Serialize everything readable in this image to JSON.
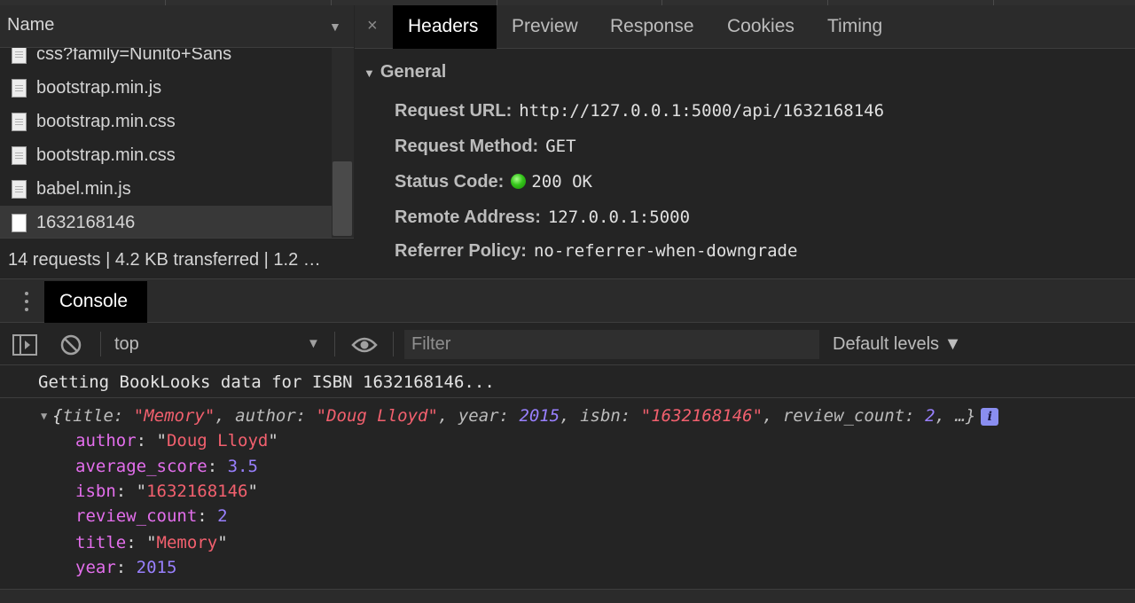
{
  "network": {
    "list_header": "Name",
    "files": [
      {
        "name": "css?family=Nunito+Sans",
        "selected": false,
        "blank": false
      },
      {
        "name": "bootstrap.min.js",
        "selected": false,
        "blank": false
      },
      {
        "name": "bootstrap.min.css",
        "selected": false,
        "blank": false
      },
      {
        "name": "bootstrap.min.css",
        "selected": false,
        "blank": false
      },
      {
        "name": "babel.min.js",
        "selected": false,
        "blank": false
      },
      {
        "name": "1632168146",
        "selected": true,
        "blank": true
      }
    ],
    "summary": "14 requests | 4.2 KB transferred | 1.2 …"
  },
  "detail": {
    "close": "×",
    "tabs": [
      "Headers",
      "Preview",
      "Response",
      "Cookies",
      "Timing"
    ],
    "active_tab": "Headers",
    "section": "General",
    "rows": {
      "url_key": "Request URL:",
      "url_val": "http://127.0.0.1:5000/api/1632168146",
      "method_key": "Request Method:",
      "method_val": "GET",
      "status_key": "Status Code:",
      "status_val": "200 OK",
      "remote_key": "Remote Address:",
      "remote_val": "127.0.0.1:5000",
      "policy_key": "Referrer Policy:",
      "policy_val": "no-referrer-when-downgrade"
    }
  },
  "console": {
    "tab": "Console",
    "context": "top",
    "filter_placeholder": "Filter",
    "levels": "Default levels ▼",
    "log_message": "Getting BookLooks data for ISBN 1632168146...",
    "summary": {
      "open": "{",
      "title_k": "title: ",
      "title_v": "\"Memory\"",
      "author_k": ", author: ",
      "author_v": "\"Doug Lloyd\"",
      "year_k": ", year: ",
      "year_v": "2015",
      "isbn_k": ", isbn: ",
      "isbn_v": "\"1632168146\"",
      "rc_k": ", review_count: ",
      "rc_v": "2",
      "tail": ", …}",
      "info": "i"
    },
    "props": {
      "author_k": "author",
      "author_v": "Doug Lloyd",
      "avg_k": "average_score",
      "avg_v": "3.5",
      "isbn_k": "isbn",
      "isbn_v": "1632168146",
      "rc_k": "review_count",
      "rc_v": "2",
      "title_k": "title",
      "title_v": "Memory",
      "year_k": "year",
      "year_v": "2015"
    }
  }
}
